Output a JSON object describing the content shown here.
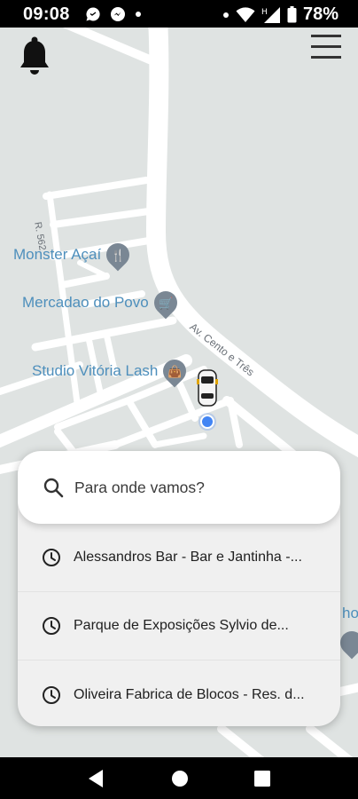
{
  "status_bar": {
    "time": "09:08",
    "battery_percent": "78%",
    "left_icons": [
      "chat-icon",
      "messenger-icon",
      "notification-dot-icon"
    ],
    "right_icons": [
      "dot-icon",
      "wifi-icon",
      "signal-icon",
      "battery-icon"
    ]
  },
  "map": {
    "background_color": "#dfe3e2",
    "road_color": "#ffffff",
    "poi_color": "#4e8fbc",
    "pois": [
      {
        "name": "Monster Açaí",
        "icon": "restaurant-icon"
      },
      {
        "name": "Mercadao do Povo",
        "icon": "shopping-cart-icon"
      },
      {
        "name": "Studio Vitória Lash",
        "icon": "shopping-bag-icon"
      }
    ],
    "street_labels": [
      "R. 562",
      "Av. Cento e Três"
    ],
    "edge_label": "ho"
  },
  "header": {
    "notifications_icon": "bell-icon",
    "menu_icon": "hamburger-menu-icon"
  },
  "search": {
    "placeholder": "Para onde vamos?",
    "icon": "search-icon",
    "recent": [
      {
        "label": "Alessandros Bar - Bar e Jantinha -...",
        "icon": "clock-icon"
      },
      {
        "label": "Parque de Exposições Sylvio de...",
        "icon": "clock-icon"
      },
      {
        "label": "Oliveira Fabrica de Blocos - Res. d...",
        "icon": "clock-icon"
      }
    ]
  },
  "nav_bar": {
    "buttons": [
      "back-icon",
      "home-icon",
      "recents-icon"
    ]
  }
}
